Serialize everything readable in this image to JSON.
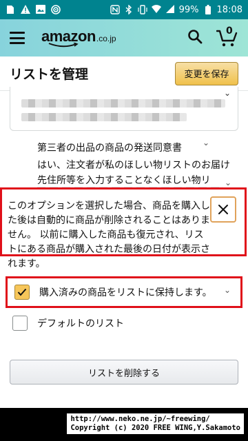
{
  "status_bar": {
    "battery": "99%",
    "time": "18:08",
    "left_icons": [
      "sim-card-icon",
      "warning-icon",
      "image-icon",
      "hotspot-icon"
    ],
    "right_icons": [
      "nfc-icon",
      "bluetooth-icon",
      "vibrate-icon",
      "wifi-icon",
      "signal-icon",
      "battery-icon"
    ]
  },
  "header": {
    "logo_text": "amazon",
    "logo_tld": ".co.jp",
    "cart_count": "0",
    "background_gradient": [
      "#87d3dc",
      "#9ee5d6"
    ]
  },
  "title_row": {
    "title": "リストを管理",
    "save_label": "変更を保存"
  },
  "third_party": {
    "title": "第三者の出品の商品の発送同意書",
    "body": "はい、注文者が私のほしい物リストのお届け先住所等を入力することなくほしい物リ"
  },
  "popover": {
    "text": "このオプションを選択した場合、商品を購入した後は自動的に商品が削除されることはありません。 以前に購入した商品も復元され、リストにある商品が購入された最後の日付が表示されます。",
    "close_label": "✕"
  },
  "keep_purchased": {
    "label": "購入済みの商品をリストに保持します。",
    "checked": true
  },
  "default_list": {
    "label": "デフォルトのリスト",
    "checked": false
  },
  "delete_button": {
    "label": "リストを削除する"
  },
  "copyright": {
    "line1": "http://www.neko.ne.jp/~freewing/",
    "line2": "Copyright (c) 2020 FREE WING,Y.Sakamoto"
  },
  "colors": {
    "status_bar": "#00838f",
    "save_button": "#f0c14b",
    "highlight_border": "#e0101a"
  }
}
